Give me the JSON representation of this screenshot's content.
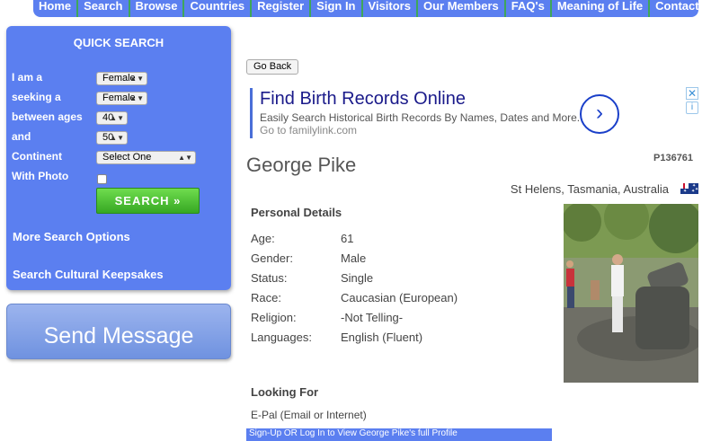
{
  "nav": [
    "Home",
    "Search",
    "Browse",
    "Countries",
    "Register",
    "Sign In",
    "Visitors",
    "Our Members",
    "FAQ's",
    "Meaning of Life",
    "Contact us"
  ],
  "quick_search": {
    "title": "QUICK SEARCH",
    "i_am_label": "I am a",
    "i_am_value": "Female",
    "seeking_label": "seeking a",
    "seeking_value": "Female",
    "between_label": "between ages",
    "age_from": "40",
    "and_label": "and",
    "age_to": "50",
    "continent_label": "Continent",
    "continent_value": "Select One",
    "photo_label": "With Photo",
    "search_button": "SEARCH",
    "more_options": "More Search Options",
    "cultural": "Search Cultural Keepsakes"
  },
  "send_message": "Send Message",
  "go_back": "Go Back",
  "ad": {
    "title": "Find Birth Records Online",
    "description": "Easily Search Historical Birth Records By Names, Dates and More.",
    "url": "Go to familylink.com",
    "arrow": "›",
    "close": "✕",
    "info": "i"
  },
  "profile": {
    "name": "George Pike",
    "id": "P136761",
    "location": "St Helens,  Tasmania,  Australia",
    "flag_icon": "australia-flag-icon",
    "personal_title": "Personal Details",
    "details": [
      {
        "label": "Age:",
        "value": "61"
      },
      {
        "label": "Gender:",
        "value": "Male"
      },
      {
        "label": "Status:",
        "value": "Single"
      },
      {
        "label": "Race:",
        "value": "Caucasian (European)"
      },
      {
        "label": "Religion:",
        "value": "-Not Telling-"
      },
      {
        "label": "Languages:",
        "value": "English (Fluent)"
      }
    ],
    "looking_title": "Looking For",
    "looking_value": "E-Pal (Email or Internet)",
    "signup_text": "Sign-Up OR Log In to View George Pike's full Profile"
  }
}
